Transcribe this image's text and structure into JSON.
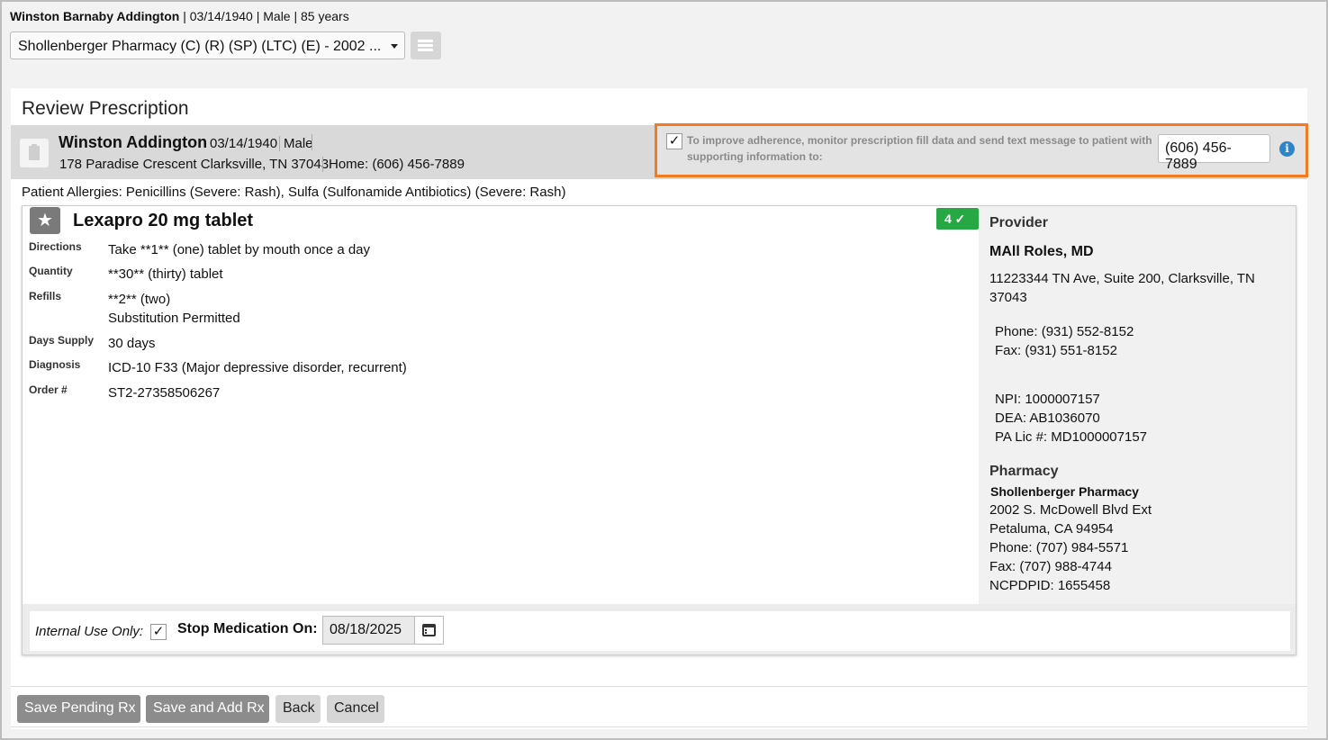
{
  "header": {
    "patient_name": "Winston Barnaby Addington",
    "patient_meta": " | 03/14/1940 | Male | 85 years",
    "pharmacy_select": "Shollenberger Pharmacy (C) (R) (SP) (LTC) (E) - 2002 ..."
  },
  "review": {
    "title": "Review Prescription",
    "patient": {
      "name": "Winston Addington",
      "dob": "03/14/1940",
      "sex": "Male",
      "address": "178 Paradise Crescent Clarksville, TN 37043",
      "home_phone": "Home: (606) 456-7889"
    },
    "adherence": {
      "checked": "✓",
      "text": "To improve adherence, monitor prescription fill data and send text message to patient with supporting information to:",
      "phone": "(606) 456-7889",
      "info": "i"
    },
    "allergies": "Patient Allergies: Penicillins (Severe: Rash), Sulfa (Sulfonamide Antibiotics) (Severe: Rash)"
  },
  "rx": {
    "drug_name": "Lexapro 20 mg tablet",
    "badge": "4 ✓",
    "fields": {
      "directions_label": "Directions",
      "directions": "Take **1** (one) tablet by mouth once a day",
      "quantity_label": "Quantity",
      "quantity": "**30** (thirty) tablet",
      "refills_label": "Refills",
      "refills": "**2** (two)",
      "substitution": "Substitution Permitted",
      "days_label": "Days Supply",
      "days": "30 days",
      "diagnosis_label": "Diagnosis",
      "diagnosis": "ICD-10 F33 (Major depressive disorder, recurrent)",
      "order_label": "Order #",
      "order": "ST2-27358506267"
    }
  },
  "provider": {
    "heading": "Provider",
    "name": "MAll Roles, MD",
    "address1": "11223344 TN Ave, Suite 200, Clarksville, TN",
    "address2": "37043",
    "phone": "Phone: (931) 552-8152",
    "fax": "Fax: (931) 551-8152",
    "npi": "NPI: 1000007157",
    "dea": "DEA: AB1036070",
    "lic": "PA Lic #: MD1000007157"
  },
  "pharmacy": {
    "heading": "Pharmacy",
    "name": "Shollenberger Pharmacy",
    "address1": "2002 S. McDowell Blvd Ext",
    "address2": "Petaluma, CA 94954",
    "phone": "Phone: (707) 984-5571",
    "fax": "Fax: (707) 988-4744",
    "ncpdpid": "NCPDPID: 1655458"
  },
  "stop": {
    "internal_label": "Internal Use Only:",
    "internal_checked": "✓",
    "label": "Stop Medication On:",
    "date": "08/18/2025"
  },
  "buttons": {
    "save_pending": "Save Pending Rx",
    "save_add": "Save and Add Rx",
    "back": "Back",
    "cancel": "Cancel"
  },
  "colors": {
    "highlight_border": "#f47a20",
    "badge_green": "#27a844",
    "info_blue": "#2b86c9"
  }
}
